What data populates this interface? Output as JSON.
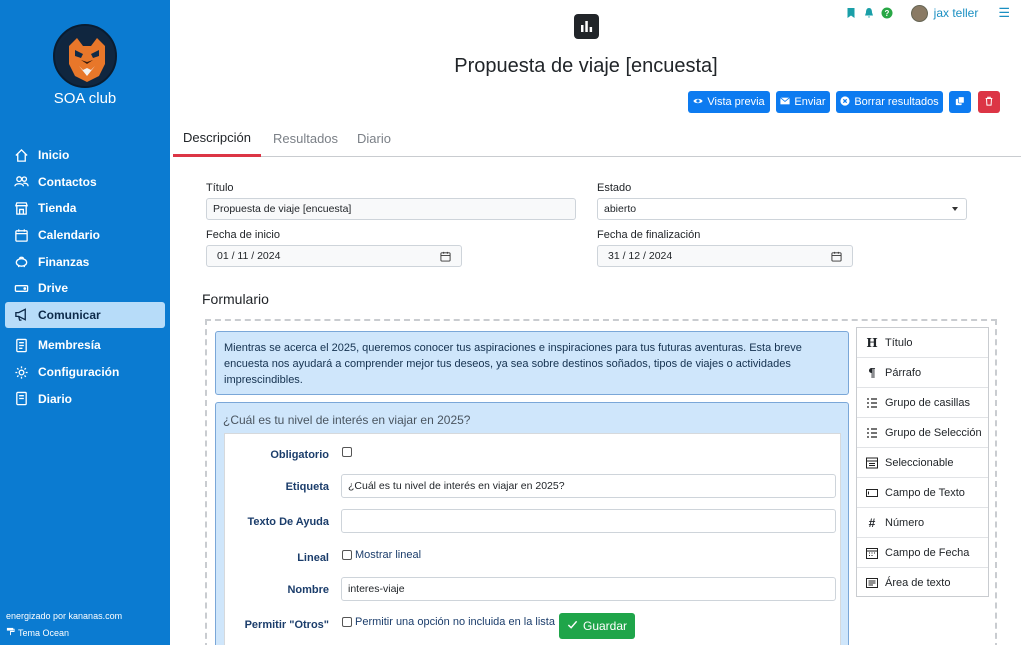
{
  "sidebar": {
    "club_name": "SOA club",
    "items": [
      {
        "label": "Inicio",
        "icon": "home-icon"
      },
      {
        "label": "Contactos",
        "icon": "users-icon"
      },
      {
        "label": "Tienda",
        "icon": "shop-icon"
      },
      {
        "label": "Calendario",
        "icon": "calendar-icon"
      },
      {
        "label": "Finanzas",
        "icon": "piggy-bank-icon"
      },
      {
        "label": "Drive",
        "icon": "drive-icon"
      },
      {
        "label": "Comunicar",
        "icon": "megaphone-icon",
        "active": true
      },
      {
        "label": "Membresía",
        "icon": "card-icon"
      },
      {
        "label": "Configuración",
        "icon": "gear-icon"
      },
      {
        "label": "Diario",
        "icon": "journal-icon"
      }
    ],
    "powered_by": "energizado por kananas.com",
    "theme": "Tema Ocean"
  },
  "topbar": {
    "user_name": "jax teller",
    "icons": [
      "bookmark-icon",
      "bell-icon",
      "help-icon",
      "menu-icon"
    ]
  },
  "header": {
    "title": "Propuesta de viaje [encuesta]"
  },
  "actions": {
    "preview": "Vista previa",
    "send": "Enviar",
    "clear": "Borrar resultados"
  },
  "tabs": [
    {
      "label": "Descripción",
      "active": true
    },
    {
      "label": "Resultados"
    },
    {
      "label": "Diario"
    }
  ],
  "form": {
    "title_label": "Título",
    "title_value": "Propuesta de viaje [encuesta]",
    "status_label": "Estado",
    "status_value": "abierto",
    "start_label": "Fecha de inicio",
    "start_value": "01 / 11 / 2024",
    "end_label": "Fecha de finalización",
    "end_value": "31 / 12 / 2024"
  },
  "builder": {
    "section_title": "Formulario",
    "intro": "Mientras se acerca el 2025, queremos conocer tus aspiraciones e inspiraciones para tus futuras aventuras. Esta breve encuesta nos ayudará a comprender mejor tus deseos, ya sea sobre destinos soñados, tipos de viajes o actividades imprescindibles.",
    "question_title": "¿Cuál es tu nivel de interés en viajar en 2025?",
    "fields": {
      "required_label": "Obligatorio",
      "label_label": "Etiqueta",
      "label_value": "¿Cuál es tu nivel de interés en viajar en 2025?",
      "help_label": "Texto De Ayuda",
      "help_value": "",
      "inline_label": "Lineal",
      "inline_option": "Mostrar lineal",
      "name_label": "Nombre",
      "name_value": "interes-viaje",
      "other_label": "Permitir \"Otros\"",
      "other_option": "Permitir una opción no incluida en la lista"
    },
    "save_label": "Guardar"
  },
  "palette": [
    {
      "label": "Título",
      "icon": "heading-icon"
    },
    {
      "label": "Párrafo",
      "icon": "paragraph-icon"
    },
    {
      "label": "Grupo de casillas",
      "icon": "checkbox-group-icon"
    },
    {
      "label": "Grupo de Selección",
      "icon": "radio-group-icon"
    },
    {
      "label": "Seleccionable",
      "icon": "select-icon"
    },
    {
      "label": "Campo de Texto",
      "icon": "text-field-icon"
    },
    {
      "label": "Número",
      "icon": "number-icon"
    },
    {
      "label": "Campo de Fecha",
      "icon": "date-field-icon"
    },
    {
      "label": "Área de texto",
      "icon": "textarea-icon"
    }
  ],
  "colors": {
    "sidebar": "#0b7bd1",
    "active_nav": "#b7dcf9",
    "primary_button": "#0d7bf0",
    "danger_button": "#dc3545",
    "save_button": "#1fa54a",
    "card_bg": "#cfe6fb"
  }
}
